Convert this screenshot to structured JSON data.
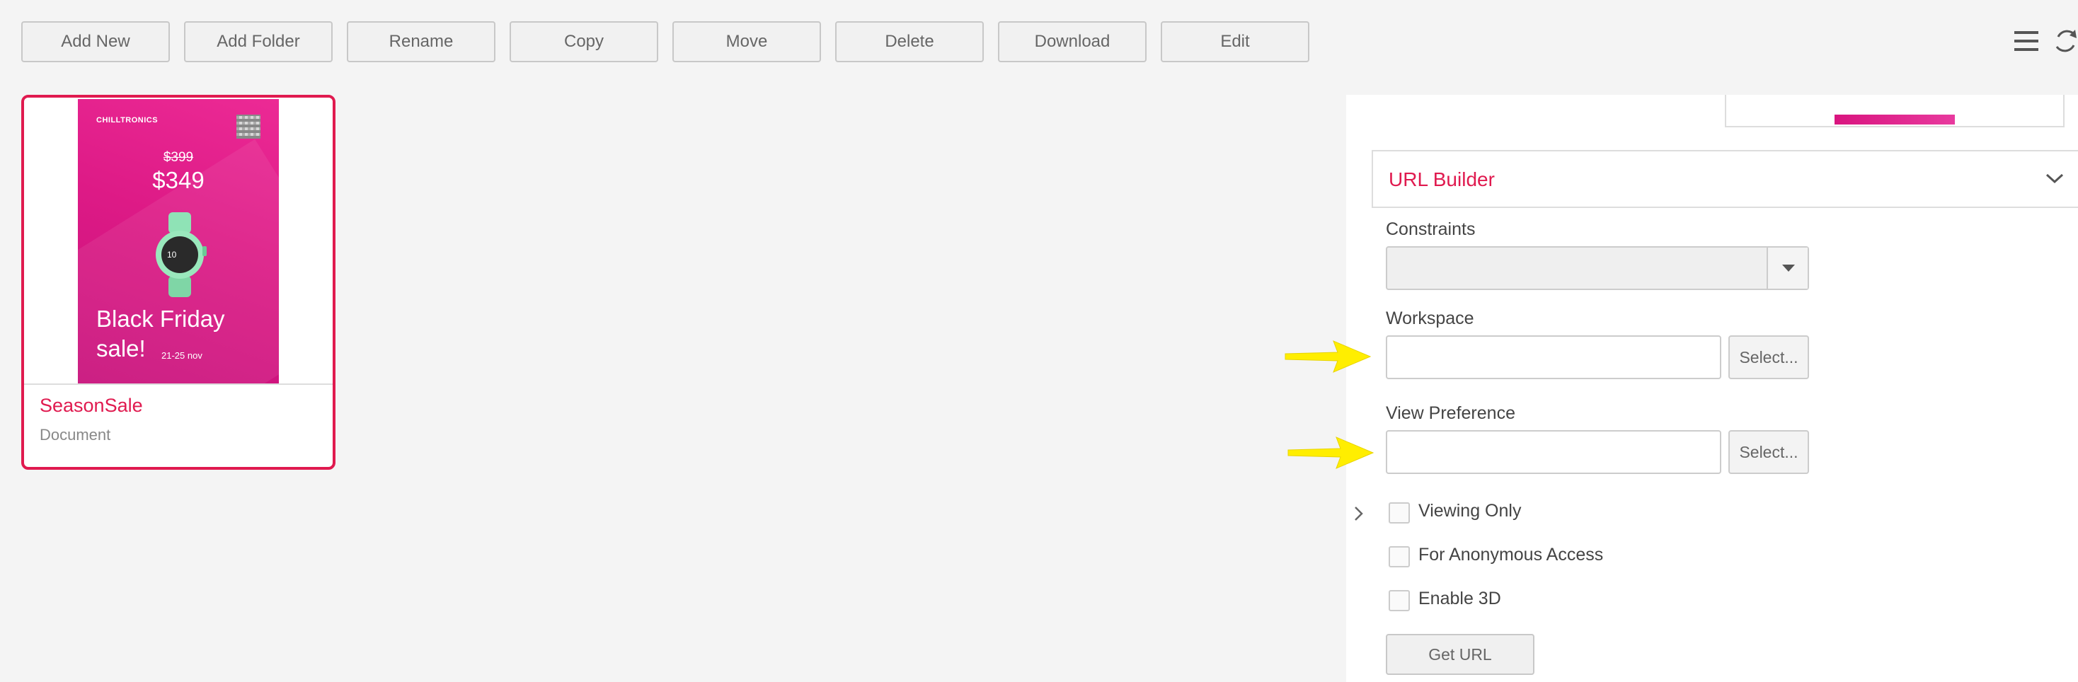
{
  "toolbar": {
    "buttons": [
      "Add New",
      "Add Folder",
      "Rename",
      "Copy",
      "Move",
      "Delete",
      "Download",
      "Edit"
    ],
    "icons": [
      "menu-icon",
      "refresh-icon"
    ]
  },
  "asset": {
    "name": "SeasonSale",
    "type": "Document",
    "thumbnail": {
      "brand": "CHILLTRONICS",
      "old_price": "$399",
      "new_price": "$349",
      "promo": "Black Friday sale!",
      "promo_line1": "Black Friday",
      "promo_line2": "sale!",
      "dates": "21-25 nov",
      "watch_time": "10"
    }
  },
  "panel": {
    "section_title": "URL Builder",
    "constraints_label": "Constraints",
    "constraints_value": "",
    "workspace_label": "Workspace",
    "workspace_value": "",
    "workspace_select": "Select...",
    "view_pref_label": "View Preference",
    "view_pref_value": "",
    "view_pref_select": "Select...",
    "checkboxes": [
      {
        "label": "Viewing Only",
        "checked": false
      },
      {
        "label": "For Anonymous Access",
        "checked": false
      },
      {
        "label": "Enable 3D",
        "checked": false
      }
    ],
    "get_url_label": "Get URL"
  },
  "colors": {
    "accent": "#e01a4f",
    "tab_active": "#d9157f",
    "highlight_arrow": "#ffee00"
  }
}
